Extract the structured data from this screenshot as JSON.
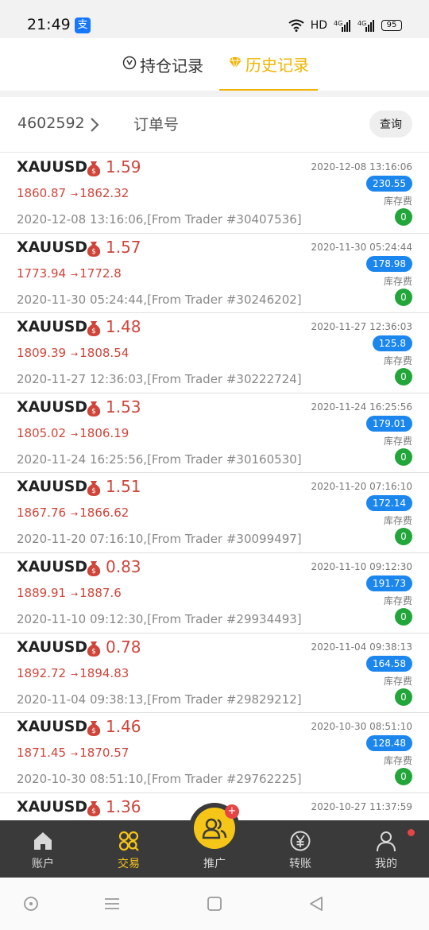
{
  "status_bar": {
    "time": "21:49",
    "alipay_glyph": "支",
    "network_label": "HD",
    "signal_1": "4G",
    "signal_2": "4G",
    "battery": "95"
  },
  "tabs": [
    {
      "label": "持仓记录",
      "icon": "clock-circle-icon",
      "active": false
    },
    {
      "label": "历史记录",
      "icon": "diamond-icon",
      "active": true
    }
  ],
  "filter": {
    "account_id": "4602592",
    "order_placeholder": "订单号",
    "query_label": "查询"
  },
  "colors": {
    "accent": "#f0b400",
    "price_red": "#d0453a",
    "amount_blue": "#1b87ee",
    "badge_green": "#22a63a",
    "nav_bg": "#3a3a3a"
  },
  "records": [
    {
      "symbol": "XAUUSD,",
      "lots": "1.59",
      "open_price": "1860.87",
      "close_price": "1862.32",
      "note": "2020-12-08 13:16:06,[From Trader #30407536]",
      "time": "2020-12-08 13:16:06",
      "amount": "230.55",
      "fee_label": "库存费",
      "fee": "0"
    },
    {
      "symbol": "XAUUSD,",
      "lots": "1.57",
      "open_price": "1773.94",
      "close_price": "1772.8",
      "note": "2020-11-30 05:24:44,[From Trader #30246202]",
      "time": "2020-11-30 05:24:44",
      "amount": "178.98",
      "fee_label": "库存费",
      "fee": "0"
    },
    {
      "symbol": "XAUUSD,",
      "lots": "1.48",
      "open_price": "1809.39",
      "close_price": "1808.54",
      "note": "2020-11-27 12:36:03,[From Trader #30222724]",
      "time": "2020-11-27 12:36:03",
      "amount": "125.8",
      "fee_label": "库存费",
      "fee": "0"
    },
    {
      "symbol": "XAUUSD,",
      "lots": "1.53",
      "open_price": "1805.02",
      "close_price": "1806.19",
      "note": "2020-11-24 16:25:56,[From Trader #30160530]",
      "time": "2020-11-24 16:25:56",
      "amount": "179.01",
      "fee_label": "库存费",
      "fee": "0"
    },
    {
      "symbol": "XAUUSD,",
      "lots": "1.51",
      "open_price": "1867.76",
      "close_price": "1866.62",
      "note": "2020-11-20 07:16:10,[From Trader #30099497]",
      "time": "2020-11-20 07:16:10",
      "amount": "172.14",
      "fee_label": "库存费",
      "fee": "0"
    },
    {
      "symbol": "XAUUSD,",
      "lots": "0.83",
      "open_price": "1889.91",
      "close_price": "1887.6",
      "note": "2020-11-10 09:12:30,[From Trader #29934493]",
      "time": "2020-11-10 09:12:30",
      "amount": "191.73",
      "fee_label": "库存费",
      "fee": "0"
    },
    {
      "symbol": "XAUUSD,",
      "lots": "0.78",
      "open_price": "1892.72",
      "close_price": "1894.83",
      "note": "2020-11-04 09:38:13,[From Trader #29829212]",
      "time": "2020-11-04 09:38:13",
      "amount": "164.58",
      "fee_label": "库存费",
      "fee": "0"
    },
    {
      "symbol": "XAUUSD,",
      "lots": "1.46",
      "open_price": "1871.45",
      "close_price": "1870.57",
      "note": "2020-10-30 08:51:10,[From Trader #29762225]",
      "time": "2020-10-30 08:51:10",
      "amount": "128.48",
      "fee_label": "库存费",
      "fee": "0"
    },
    {
      "symbol": "XAUUSD,",
      "lots": "1.36",
      "open_price": "",
      "close_price": "",
      "note": "",
      "time": "2020-10-27 11:37:59",
      "amount": "",
      "fee_label": "",
      "fee": ""
    }
  ],
  "bottom_nav": {
    "items": [
      {
        "label": "账户",
        "icon": "home-icon"
      },
      {
        "label": "交易",
        "icon": "trade-icon",
        "active": true
      },
      {
        "label": "推广",
        "icon": "users-icon",
        "badge": "+"
      },
      {
        "label": "转账",
        "icon": "yen-icon"
      },
      {
        "label": "我的",
        "icon": "person-icon",
        "dot": true
      }
    ]
  },
  "system_nav": [
    "circle-icon",
    "menu-icon",
    "square-icon",
    "back-icon"
  ]
}
